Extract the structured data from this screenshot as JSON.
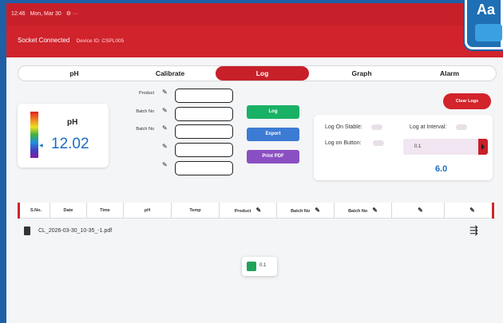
{
  "status_bar": {
    "time": "12:46",
    "date": "Mon, Mar 30",
    "extra": "⚙ ···"
  },
  "header": {
    "connection": "Socket Connected",
    "device_id": "Device ID: CSPL005"
  },
  "badge": {
    "label": "Aa"
  },
  "tabs": [
    {
      "label": "pH",
      "active": false
    },
    {
      "label": "Calibrate",
      "active": false
    },
    {
      "label": "Log",
      "active": true
    },
    {
      "label": "Graph",
      "active": false
    },
    {
      "label": "Alarm",
      "active": false
    }
  ],
  "ph_card": {
    "label": "pH",
    "value": "12.02",
    "marker": "◀"
  },
  "fields": [
    {
      "label": "Product",
      "value": ""
    },
    {
      "label": "Batch No",
      "value": ""
    },
    {
      "label": "Batch No",
      "value": ""
    },
    {
      "label": "",
      "value": ""
    },
    {
      "label": "",
      "value": ""
    }
  ],
  "buttons": {
    "log": "Log",
    "export": "Export",
    "print_pdf": "Print PDF",
    "clear_logs": "Clear Logs"
  },
  "settings": {
    "log_on_stable": "Log On Stable:",
    "log_on_button": "Log on Button:",
    "log_at_interval": "Log at Interval:",
    "interval_input": "0.1",
    "interval_value": "6.0"
  },
  "table": {
    "columns": [
      "S.No.",
      "Date",
      "Time",
      "pH",
      "Temp",
      "Product",
      "Batch No",
      "Batch No",
      "",
      ""
    ]
  },
  "file": {
    "name": "CL_2026-03-30_10-35_-1.pdf"
  },
  "toast": {
    "text": "0.1"
  },
  "icons": {
    "pencil": "✎",
    "share": "⇶"
  },
  "colors": {
    "primary_red": "#c8202a",
    "accent_blue": "#1c6cc3",
    "log_green": "#19b165",
    "export_blue": "#3c7bd4",
    "pdf_purple": "#8a4fc2"
  }
}
